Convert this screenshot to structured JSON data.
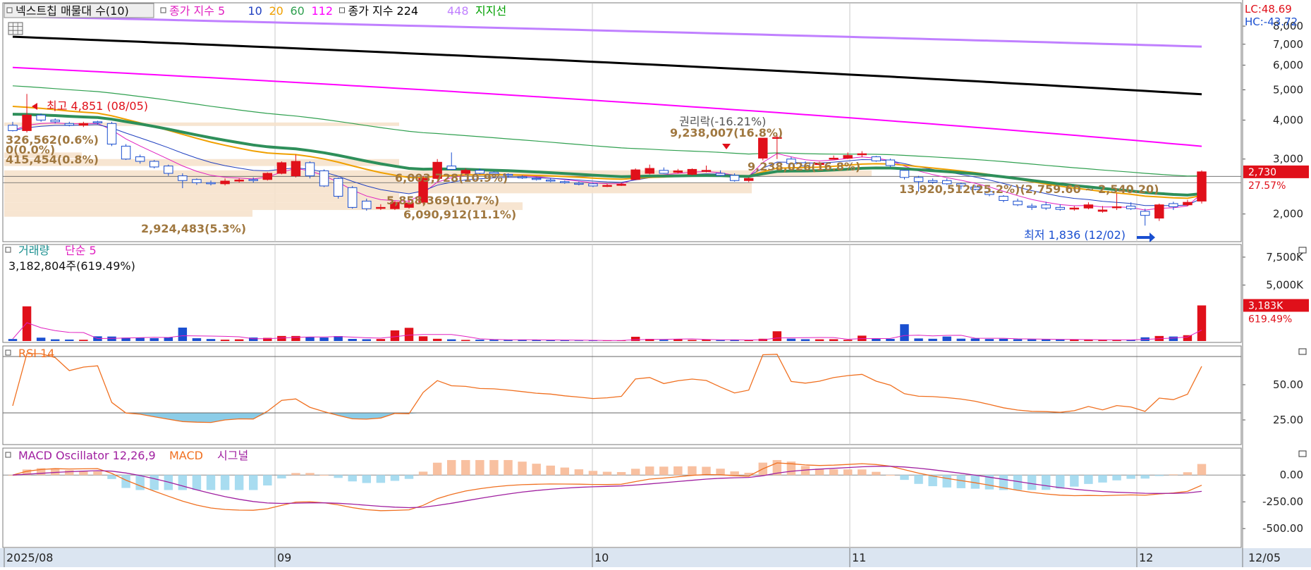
{
  "header": {
    "title": "넥스트칩 매물대 수(10)",
    "legend_items": [
      {
        "label": "종가 지수 5",
        "color": "#e020c0"
      },
      {
        "label": "10",
        "color": "#2040c0"
      },
      {
        "label": "20",
        "color": "#f0a000"
      },
      {
        "label": "60",
        "color": "#30a050"
      },
      {
        "label": "112",
        "color": "#ff00ff"
      },
      {
        "label": "종가 지수 224",
        "color": "#000000"
      },
      {
        "label": "448",
        "color": "#c080ff"
      },
      {
        "label": "지지선",
        "color": "#00a000"
      }
    ],
    "lc": "LC:48.69",
    "hc": "HC:-43.72"
  },
  "price_axis": {
    "ticks": [
      "8,000",
      "7,000",
      "6,000",
      "5,000",
      "4,000",
      "3,000",
      "2,000"
    ],
    "current_price": "2,730",
    "current_pct": "27.57%"
  },
  "annotations": {
    "high": "최고 4,851 (08/05)",
    "low": "최저 1,836 (12/02)",
    "ex_rights": "권리락(-16.21%)",
    "ex_rights_vol": "9,238,007(16.8%)",
    "vp_labels": [
      "326,562(0.6%)",
      "0(0.0%)",
      "415,454(0.8%)",
      "6,003,728(10.9%)",
      "5,858,369(10.7%)",
      "6,090,912(11.1%)",
      "2,924,483(5.3%)",
      "9,238,026(16.8%)",
      "13,920,512(25.2%)(2,759.60 ~ 2,540.20)"
    ]
  },
  "volume_panel": {
    "legend": [
      "거래량",
      "단순 5"
    ],
    "legend_colors": [
      "#1a8f8f",
      "#e020c0"
    ],
    "max_label": "3,182,804주(619.49%)",
    "ticks": [
      "7,500K",
      "5,000K"
    ],
    "current": "3,183K",
    "current_pct": "619.49%"
  },
  "rsi_panel": {
    "legend": "RSI 14",
    "ticks": [
      "50.00",
      "25.00"
    ]
  },
  "macd_panel": {
    "legend": [
      "MACD Oscillator 12,26,9",
      "MACD",
      "시그널"
    ],
    "legend_colors": [
      "#a020a0",
      "#f07020",
      "#a020a0"
    ],
    "ticks": [
      "0.00",
      "-250.00",
      "-500.00"
    ]
  },
  "time_axis": {
    "labels": [
      "2025/08",
      "09",
      "10",
      "11",
      "12"
    ],
    "end_label": "12/05"
  },
  "chart_data": {
    "type": "candlestick",
    "dates": [
      "08/01",
      "08/04",
      "08/05",
      "08/06",
      "08/07",
      "08/08",
      "08/11",
      "08/12",
      "08/13",
      "08/14",
      "08/18",
      "08/19",
      "08/20",
      "08/21",
      "08/22",
      "08/25",
      "08/26",
      "08/27",
      "08/28",
      "08/29",
      "09/01",
      "09/02",
      "09/03",
      "09/04",
      "09/05",
      "09/08",
      "09/09",
      "09/10",
      "09/11",
      "09/12",
      "09/15",
      "09/16",
      "09/17",
      "09/18",
      "09/19",
      "09/22",
      "09/23",
      "09/24",
      "09/25",
      "09/26",
      "09/29",
      "09/30",
      "10/01",
      "10/02",
      "10/10",
      "10/13",
      "10/14",
      "10/15",
      "10/16",
      "10/17",
      "10/20",
      "10/21",
      "10/22",
      "10/23",
      "10/24",
      "10/27",
      "10/28",
      "10/29",
      "10/30",
      "10/31",
      "11/03",
      "11/04",
      "11/05",
      "11/06",
      "11/07",
      "11/10",
      "11/11",
      "11/12",
      "11/13",
      "11/14",
      "11/17",
      "11/18",
      "11/19",
      "11/20",
      "11/21",
      "11/24",
      "11/25",
      "11/26",
      "11/27",
      "11/28",
      "12/01",
      "12/02",
      "12/03",
      "12/04",
      "12/05"
    ],
    "open": [
      3850,
      3700,
      4150,
      4000,
      3900,
      3850,
      3950,
      3900,
      3300,
      3050,
      2950,
      2850,
      2650,
      2580,
      2520,
      2500,
      2560,
      2580,
      2580,
      2700,
      2650,
      2920,
      2750,
      2600,
      2430,
      2200,
      2100,
      2080,
      2100,
      2180,
      2600,
      2850,
      2700,
      2760,
      2720,
      2680,
      2630,
      2600,
      2570,
      2540,
      2510,
      2500,
      2470,
      2480,
      2580,
      2700,
      2760,
      2720,
      2680,
      2740,
      2700,
      2660,
      2560,
      3020,
      3500,
      3000,
      2920,
      2880,
      3020,
      3020,
      3100,
      3050,
      2980,
      2760,
      2620,
      2560,
      2560,
      2500,
      2440,
      2360,
      2280,
      2200,
      2120,
      2140,
      2100,
      2080,
      2090,
      2040,
      2100,
      2120,
      2040,
      1940,
      2160,
      2140,
      2200
    ],
    "close": [
      3700,
      4150,
      4000,
      3950,
      3850,
      3900,
      3920,
      3350,
      3000,
      2950,
      2830,
      2700,
      2560,
      2520,
      2500,
      2550,
      2570,
      2560,
      2700,
      2920,
      2950,
      2650,
      2460,
      2280,
      2100,
      2080,
      2100,
      2180,
      2170,
      2600,
      2930,
      2780,
      2760,
      2700,
      2690,
      2660,
      2620,
      2580,
      2560,
      2520,
      2490,
      2460,
      2470,
      2490,
      2770,
      2800,
      2700,
      2750,
      2780,
      2760,
      2660,
      2560,
      2600,
      3500,
      3520,
      2900,
      2850,
      2910,
      3020,
      3080,
      3120,
      2960,
      2860,
      2620,
      2540,
      2530,
      2500,
      2460,
      2400,
      2310,
      2210,
      2140,
      2100,
      2090,
      2070,
      2090,
      2140,
      2060,
      2110,
      2080,
      1980,
      2140,
      2110,
      2180,
      2730
    ],
    "high": [
      3950,
      4851,
      4200,
      4050,
      3950,
      3950,
      3980,
      3950,
      3350,
      3100,
      2980,
      2880,
      2700,
      2600,
      2560,
      2600,
      2600,
      2620,
      2720,
      2950,
      3100,
      2950,
      2780,
      2620,
      2460,
      2240,
      2150,
      2200,
      2220,
      2650,
      3000,
      3150,
      2800,
      2800,
      2740,
      2700,
      2660,
      2620,
      2600,
      2560,
      2540,
      2520,
      2500,
      2520,
      2800,
      2880,
      2820,
      2790,
      2800,
      2860,
      2760,
      2700,
      2620,
      3050,
      3600,
      3050,
      2950,
      2940,
      3080,
      3150,
      3180,
      3070,
      3010,
      2780,
      2650,
      2600,
      2600,
      2520,
      2480,
      2400,
      2300,
      2240,
      2160,
      2190,
      2150,
      2120,
      2180,
      2120,
      2330,
      2180,
      2080,
      2160,
      2190,
      2220,
      2760
    ],
    "low": [
      3680,
      3650,
      3950,
      3900,
      3820,
      3800,
      3880,
      3300,
      2980,
      2900,
      2800,
      2650,
      2420,
      2480,
      2470,
      2470,
      2520,
      2520,
      2560,
      2680,
      2620,
      2600,
      2440,
      2240,
      2080,
      2050,
      2060,
      2060,
      2080,
      2150,
      2580,
      2760,
      2680,
      2680,
      2660,
      2620,
      2590,
      2560,
      2530,
      2500,
      2470,
      2440,
      2440,
      2460,
      2570,
      2680,
      2690,
      2700,
      2660,
      2720,
      2640,
      2540,
      2530,
      2970,
      3000,
      2880,
      2820,
      2840,
      2990,
      3000,
      3040,
      2940,
      2820,
      2580,
      2360,
      2500,
      2480,
      2400,
      2380,
      2280,
      2180,
      2120,
      2060,
      2060,
      2050,
      2050,
      2070,
      2020,
      2060,
      2060,
      1836,
      1900,
      2060,
      2120,
      2160
    ],
    "volume": [
      180,
      3100,
      300,
      150,
      130,
      110,
      420,
      400,
      300,
      280,
      250,
      330,
      1200,
      250,
      180,
      120,
      150,
      310,
      280,
      450,
      450,
      350,
      310,
      440,
      190,
      160,
      180,
      950,
      1180,
      420,
      200,
      150,
      100,
      120,
      110,
      90,
      120,
      90,
      70,
      60,
      40,
      60,
      30,
      50,
      380,
      190,
      110,
      160,
      100,
      120,
      80,
      90,
      70,
      200,
      870,
      210,
      160,
      150,
      160,
      110,
      480,
      190,
      190,
      1500,
      230,
      200,
      400,
      210,
      230,
      180,
      200,
      160,
      150,
      140,
      120,
      130,
      100,
      90,
      80,
      90,
      330,
      450,
      400,
      520,
      3183
    ],
    "volume_unit": "K",
    "indicators": {
      "ma5": "종가 지수 5",
      "ma10": "10",
      "ma20": "20",
      "ma60": "60",
      "ma112": "112",
      "ma224": "종가 지수 224",
      "ma448": "448"
    },
    "price_log_scale": true,
    "ylim": [
      1700,
      8300
    ]
  }
}
